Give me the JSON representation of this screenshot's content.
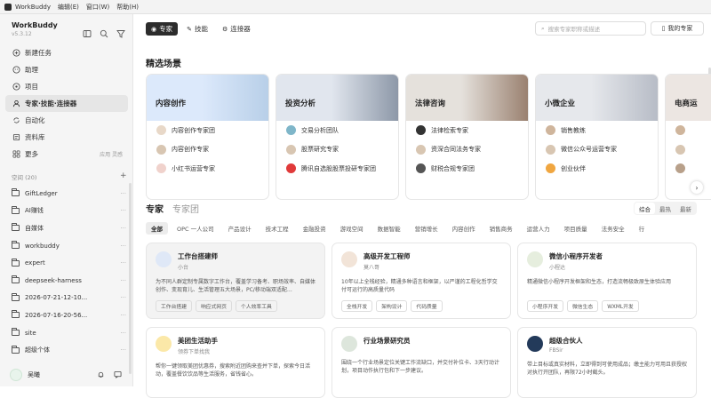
{
  "menubar": {
    "app": "WorkBuddy",
    "items": [
      "编辑(E)",
      "窗口(W)",
      "帮助(H)"
    ]
  },
  "sidebar": {
    "brand": "WorkBuddy",
    "version": "v5.3.12",
    "nav": [
      {
        "label": "新建任务",
        "icon": "plus-circle-icon"
      },
      {
        "label": "助理",
        "icon": "assistant-icon"
      },
      {
        "label": "项目",
        "icon": "project-icon"
      },
      {
        "label": "专家·技能·连接器",
        "icon": "expert-icon",
        "active": true
      },
      {
        "label": "自动化",
        "icon": "automation-icon"
      },
      {
        "label": "资料库",
        "icon": "library-icon"
      },
      {
        "label": "更多",
        "icon": "more-icon",
        "extra": "应用  灵感"
      }
    ],
    "spaces_header": "空间 (20)",
    "spaces": [
      "GiftLedger",
      "AI赚钱",
      "自媒体",
      "workbuddy",
      "expert",
      "deepseek-harness",
      "2026-07-21-12-10...",
      "2026-07-16-20-56...",
      "site",
      "超级个体"
    ],
    "user": "吴曦"
  },
  "main": {
    "tabs": [
      {
        "label": "专家",
        "icon": "expert-icon",
        "active": true
      },
      {
        "label": "技能",
        "icon": "skill-icon"
      },
      {
        "label": "连接器",
        "icon": "connector-icon"
      }
    ],
    "search_placeholder": "搜索专家职称或描述",
    "my_experts": "我的专家",
    "featured_title": "精选场景",
    "scenes": [
      {
        "title": "内容创作",
        "color": "#dce9fb",
        "items": [
          "内容创作专家团",
          "内容创作专家",
          "小红书运营专家"
        ]
      },
      {
        "title": "投资分析",
        "color": "#e1e6ee",
        "items": [
          "交易分析团队",
          "股票研究专家",
          "腾讯自选股股票投研专家团"
        ]
      },
      {
        "title": "法律咨询",
        "color": "#e5e1dc",
        "items": [
          "法律检索专家",
          "资深合同法务专家",
          "财税合规专家团"
        ]
      },
      {
        "title": "小微企业",
        "color": "#e6e8ec",
        "items": [
          "销售教练",
          "微信公众号运营专家",
          "创业伙伴"
        ]
      },
      {
        "title": "电商运",
        "color": "#ece6e2",
        "items": [
          "",
          "",
          ""
        ]
      }
    ],
    "expert_tabs": [
      "专家",
      "专家团"
    ],
    "sorts": [
      "综合",
      "最热",
      "最新"
    ],
    "categories": [
      "全部",
      "OPC 一人公司",
      "产品设计",
      "技术工程",
      "金融投资",
      "游戏空间",
      "数据智能",
      "营销增长",
      "内容创作",
      "销售商务",
      "运营人力",
      "项目质量",
      "法务安全",
      "行"
    ],
    "cards": [
      {
        "name": "工作台搭建师",
        "sub": "小台",
        "desc": "为不同人群定制专属数字工作台，覆盖学习备考、职场效率、自媒体创作、变现育儿、生活管理五大场景，PC/移动端双适配…",
        "tags": [
          "工作台搭建",
          "响应式网页",
          "个人效率工具"
        ],
        "color": "#dfe8f7"
      },
      {
        "name": "高级开发工程师",
        "sub": "莫八哥",
        "desc": "10年以上全栈经验，精通多种语言和框架，以严谨的工程化哲学交付可运行的高质量代码",
        "tags": [
          "全栈开发",
          "架构设计",
          "代码质量"
        ],
        "color": "#f2e4d8"
      },
      {
        "name": "微信小程序开发者",
        "sub": "小程达",
        "desc": "精通微信小程序开发框架和生态，打造流畅极致原生体验应用",
        "tags": [
          "小程序开发",
          "微信生态",
          "WXML开发"
        ],
        "color": "#e6eede"
      },
      {
        "name": "美团生活助手",
        "sub": "领券下单找我",
        "desc": "帮你一键领取美团优惠券，搜索附近团购来查并下单，探索今日活动，覆盖餐饮饮品等生活服务，省钱省心。",
        "tags": [],
        "color": "#fbe8a8"
      },
      {
        "name": "行业场景研究员",
        "sub": "",
        "desc": "围绕一个行业场景定位关键工作流缺口，并交付补位卡、3天行动计划，项目动作执行包和下一步建议。",
        "tags": [],
        "color": "#dde6dc"
      },
      {
        "name": "超级合伙人",
        "sub": "FBSir",
        "desc": "带上目标或真实材料，立即得到可使用成品；缴主能力可用且获授权对执行开团队，再限72小时截头。",
        "tags": [],
        "color": "#233a5a"
      }
    ]
  }
}
